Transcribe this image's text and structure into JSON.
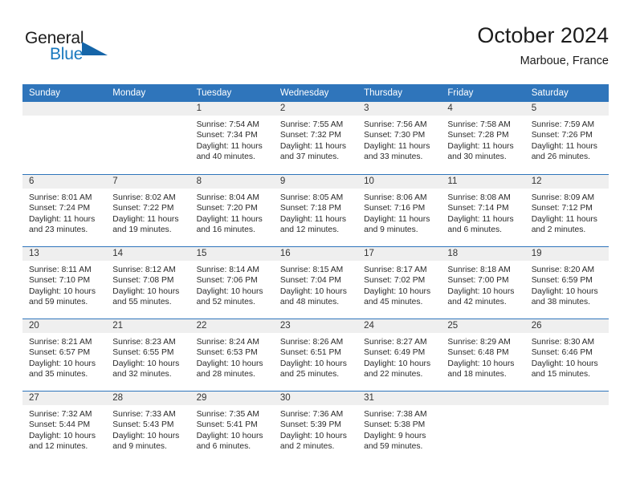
{
  "logo": {
    "text_primary": "General",
    "text_secondary": "Blue",
    "triangle_icon": "triangle-icon",
    "color_primary": "#1c1c1c",
    "color_secondary": "#1878be"
  },
  "header": {
    "month_title": "October 2024",
    "location": "Marboue, France"
  },
  "colors": {
    "header_blue": "#2f75bb",
    "day_band_gray": "#efefef",
    "text_dark": "#1c1c1c"
  },
  "weekdays": [
    "Sunday",
    "Monday",
    "Tuesday",
    "Wednesday",
    "Thursday",
    "Friday",
    "Saturday"
  ],
  "weeks": [
    [
      {
        "empty": true
      },
      {
        "empty": true
      },
      {
        "day": "1",
        "sunrise": "Sunrise: 7:54 AM",
        "sunset": "Sunset: 7:34 PM",
        "daylight_1": "Daylight: 11 hours",
        "daylight_2": "and 40 minutes."
      },
      {
        "day": "2",
        "sunrise": "Sunrise: 7:55 AM",
        "sunset": "Sunset: 7:32 PM",
        "daylight_1": "Daylight: 11 hours",
        "daylight_2": "and 37 minutes."
      },
      {
        "day": "3",
        "sunrise": "Sunrise: 7:56 AM",
        "sunset": "Sunset: 7:30 PM",
        "daylight_1": "Daylight: 11 hours",
        "daylight_2": "and 33 minutes."
      },
      {
        "day": "4",
        "sunrise": "Sunrise: 7:58 AM",
        "sunset": "Sunset: 7:28 PM",
        "daylight_1": "Daylight: 11 hours",
        "daylight_2": "and 30 minutes."
      },
      {
        "day": "5",
        "sunrise": "Sunrise: 7:59 AM",
        "sunset": "Sunset: 7:26 PM",
        "daylight_1": "Daylight: 11 hours",
        "daylight_2": "and 26 minutes."
      }
    ],
    [
      {
        "day": "6",
        "sunrise": "Sunrise: 8:01 AM",
        "sunset": "Sunset: 7:24 PM",
        "daylight_1": "Daylight: 11 hours",
        "daylight_2": "and 23 minutes."
      },
      {
        "day": "7",
        "sunrise": "Sunrise: 8:02 AM",
        "sunset": "Sunset: 7:22 PM",
        "daylight_1": "Daylight: 11 hours",
        "daylight_2": "and 19 minutes."
      },
      {
        "day": "8",
        "sunrise": "Sunrise: 8:04 AM",
        "sunset": "Sunset: 7:20 PM",
        "daylight_1": "Daylight: 11 hours",
        "daylight_2": "and 16 minutes."
      },
      {
        "day": "9",
        "sunrise": "Sunrise: 8:05 AM",
        "sunset": "Sunset: 7:18 PM",
        "daylight_1": "Daylight: 11 hours",
        "daylight_2": "and 12 minutes."
      },
      {
        "day": "10",
        "sunrise": "Sunrise: 8:06 AM",
        "sunset": "Sunset: 7:16 PM",
        "daylight_1": "Daylight: 11 hours",
        "daylight_2": "and 9 minutes."
      },
      {
        "day": "11",
        "sunrise": "Sunrise: 8:08 AM",
        "sunset": "Sunset: 7:14 PM",
        "daylight_1": "Daylight: 11 hours",
        "daylight_2": "and 6 minutes."
      },
      {
        "day": "12",
        "sunrise": "Sunrise: 8:09 AM",
        "sunset": "Sunset: 7:12 PM",
        "daylight_1": "Daylight: 11 hours",
        "daylight_2": "and 2 minutes."
      }
    ],
    [
      {
        "day": "13",
        "sunrise": "Sunrise: 8:11 AM",
        "sunset": "Sunset: 7:10 PM",
        "daylight_1": "Daylight: 10 hours",
        "daylight_2": "and 59 minutes."
      },
      {
        "day": "14",
        "sunrise": "Sunrise: 8:12 AM",
        "sunset": "Sunset: 7:08 PM",
        "daylight_1": "Daylight: 10 hours",
        "daylight_2": "and 55 minutes."
      },
      {
        "day": "15",
        "sunrise": "Sunrise: 8:14 AM",
        "sunset": "Sunset: 7:06 PM",
        "daylight_1": "Daylight: 10 hours",
        "daylight_2": "and 52 minutes."
      },
      {
        "day": "16",
        "sunrise": "Sunrise: 8:15 AM",
        "sunset": "Sunset: 7:04 PM",
        "daylight_1": "Daylight: 10 hours",
        "daylight_2": "and 48 minutes."
      },
      {
        "day": "17",
        "sunrise": "Sunrise: 8:17 AM",
        "sunset": "Sunset: 7:02 PM",
        "daylight_1": "Daylight: 10 hours",
        "daylight_2": "and 45 minutes."
      },
      {
        "day": "18",
        "sunrise": "Sunrise: 8:18 AM",
        "sunset": "Sunset: 7:00 PM",
        "daylight_1": "Daylight: 10 hours",
        "daylight_2": "and 42 minutes."
      },
      {
        "day": "19",
        "sunrise": "Sunrise: 8:20 AM",
        "sunset": "Sunset: 6:59 PM",
        "daylight_1": "Daylight: 10 hours",
        "daylight_2": "and 38 minutes."
      }
    ],
    [
      {
        "day": "20",
        "sunrise": "Sunrise: 8:21 AM",
        "sunset": "Sunset: 6:57 PM",
        "daylight_1": "Daylight: 10 hours",
        "daylight_2": "and 35 minutes."
      },
      {
        "day": "21",
        "sunrise": "Sunrise: 8:23 AM",
        "sunset": "Sunset: 6:55 PM",
        "daylight_1": "Daylight: 10 hours",
        "daylight_2": "and 32 minutes."
      },
      {
        "day": "22",
        "sunrise": "Sunrise: 8:24 AM",
        "sunset": "Sunset: 6:53 PM",
        "daylight_1": "Daylight: 10 hours",
        "daylight_2": "and 28 minutes."
      },
      {
        "day": "23",
        "sunrise": "Sunrise: 8:26 AM",
        "sunset": "Sunset: 6:51 PM",
        "daylight_1": "Daylight: 10 hours",
        "daylight_2": "and 25 minutes."
      },
      {
        "day": "24",
        "sunrise": "Sunrise: 8:27 AM",
        "sunset": "Sunset: 6:49 PM",
        "daylight_1": "Daylight: 10 hours",
        "daylight_2": "and 22 minutes."
      },
      {
        "day": "25",
        "sunrise": "Sunrise: 8:29 AM",
        "sunset": "Sunset: 6:48 PM",
        "daylight_1": "Daylight: 10 hours",
        "daylight_2": "and 18 minutes."
      },
      {
        "day": "26",
        "sunrise": "Sunrise: 8:30 AM",
        "sunset": "Sunset: 6:46 PM",
        "daylight_1": "Daylight: 10 hours",
        "daylight_2": "and 15 minutes."
      }
    ],
    [
      {
        "day": "27",
        "sunrise": "Sunrise: 7:32 AM",
        "sunset": "Sunset: 5:44 PM",
        "daylight_1": "Daylight: 10 hours",
        "daylight_2": "and 12 minutes."
      },
      {
        "day": "28",
        "sunrise": "Sunrise: 7:33 AM",
        "sunset": "Sunset: 5:43 PM",
        "daylight_1": "Daylight: 10 hours",
        "daylight_2": "and 9 minutes."
      },
      {
        "day": "29",
        "sunrise": "Sunrise: 7:35 AM",
        "sunset": "Sunset: 5:41 PM",
        "daylight_1": "Daylight: 10 hours",
        "daylight_2": "and 6 minutes."
      },
      {
        "day": "30",
        "sunrise": "Sunrise: 7:36 AM",
        "sunset": "Sunset: 5:39 PM",
        "daylight_1": "Daylight: 10 hours",
        "daylight_2": "and 2 minutes."
      },
      {
        "day": "31",
        "sunrise": "Sunrise: 7:38 AM",
        "sunset": "Sunset: 5:38 PM",
        "daylight_1": "Daylight: 9 hours",
        "daylight_2": "and 59 minutes."
      },
      {
        "empty": true
      },
      {
        "empty": true
      }
    ]
  ]
}
